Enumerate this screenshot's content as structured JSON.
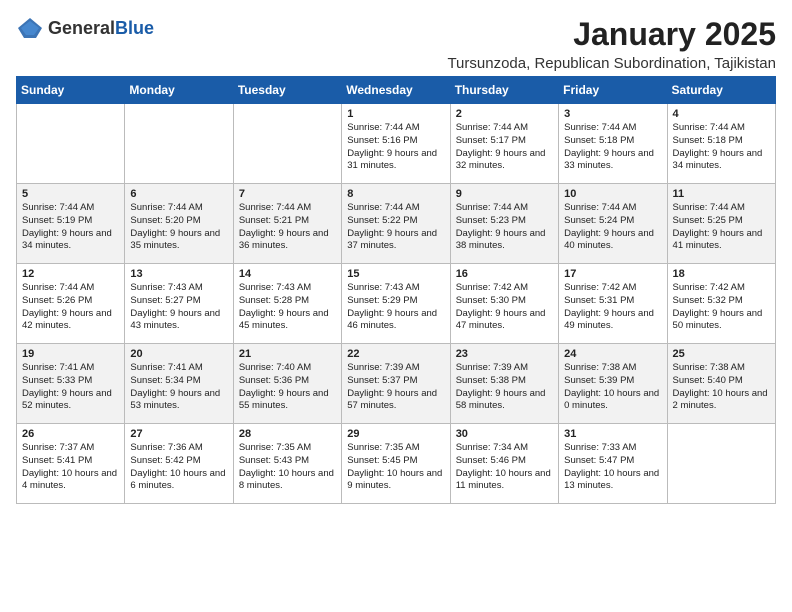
{
  "header": {
    "logo_general": "General",
    "logo_blue": "Blue",
    "month_title": "January 2025",
    "location": "Tursunzoda, Republican Subordination, Tajikistan"
  },
  "weekdays": [
    "Sunday",
    "Monday",
    "Tuesday",
    "Wednesday",
    "Thursday",
    "Friday",
    "Saturday"
  ],
  "weeks": [
    [
      {
        "day": "",
        "info": ""
      },
      {
        "day": "",
        "info": ""
      },
      {
        "day": "",
        "info": ""
      },
      {
        "day": "1",
        "info": "Sunrise: 7:44 AM\nSunset: 5:16 PM\nDaylight: 9 hours and 31 minutes."
      },
      {
        "day": "2",
        "info": "Sunrise: 7:44 AM\nSunset: 5:17 PM\nDaylight: 9 hours and 32 minutes."
      },
      {
        "day": "3",
        "info": "Sunrise: 7:44 AM\nSunset: 5:18 PM\nDaylight: 9 hours and 33 minutes."
      },
      {
        "day": "4",
        "info": "Sunrise: 7:44 AM\nSunset: 5:18 PM\nDaylight: 9 hours and 34 minutes."
      }
    ],
    [
      {
        "day": "5",
        "info": "Sunrise: 7:44 AM\nSunset: 5:19 PM\nDaylight: 9 hours and 34 minutes."
      },
      {
        "day": "6",
        "info": "Sunrise: 7:44 AM\nSunset: 5:20 PM\nDaylight: 9 hours and 35 minutes."
      },
      {
        "day": "7",
        "info": "Sunrise: 7:44 AM\nSunset: 5:21 PM\nDaylight: 9 hours and 36 minutes."
      },
      {
        "day": "8",
        "info": "Sunrise: 7:44 AM\nSunset: 5:22 PM\nDaylight: 9 hours and 37 minutes."
      },
      {
        "day": "9",
        "info": "Sunrise: 7:44 AM\nSunset: 5:23 PM\nDaylight: 9 hours and 38 minutes."
      },
      {
        "day": "10",
        "info": "Sunrise: 7:44 AM\nSunset: 5:24 PM\nDaylight: 9 hours and 40 minutes."
      },
      {
        "day": "11",
        "info": "Sunrise: 7:44 AM\nSunset: 5:25 PM\nDaylight: 9 hours and 41 minutes."
      }
    ],
    [
      {
        "day": "12",
        "info": "Sunrise: 7:44 AM\nSunset: 5:26 PM\nDaylight: 9 hours and 42 minutes."
      },
      {
        "day": "13",
        "info": "Sunrise: 7:43 AM\nSunset: 5:27 PM\nDaylight: 9 hours and 43 minutes."
      },
      {
        "day": "14",
        "info": "Sunrise: 7:43 AM\nSunset: 5:28 PM\nDaylight: 9 hours and 45 minutes."
      },
      {
        "day": "15",
        "info": "Sunrise: 7:43 AM\nSunset: 5:29 PM\nDaylight: 9 hours and 46 minutes."
      },
      {
        "day": "16",
        "info": "Sunrise: 7:42 AM\nSunset: 5:30 PM\nDaylight: 9 hours and 47 minutes."
      },
      {
        "day": "17",
        "info": "Sunrise: 7:42 AM\nSunset: 5:31 PM\nDaylight: 9 hours and 49 minutes."
      },
      {
        "day": "18",
        "info": "Sunrise: 7:42 AM\nSunset: 5:32 PM\nDaylight: 9 hours and 50 minutes."
      }
    ],
    [
      {
        "day": "19",
        "info": "Sunrise: 7:41 AM\nSunset: 5:33 PM\nDaylight: 9 hours and 52 minutes."
      },
      {
        "day": "20",
        "info": "Sunrise: 7:41 AM\nSunset: 5:34 PM\nDaylight: 9 hours and 53 minutes."
      },
      {
        "day": "21",
        "info": "Sunrise: 7:40 AM\nSunset: 5:36 PM\nDaylight: 9 hours and 55 minutes."
      },
      {
        "day": "22",
        "info": "Sunrise: 7:39 AM\nSunset: 5:37 PM\nDaylight: 9 hours and 57 minutes."
      },
      {
        "day": "23",
        "info": "Sunrise: 7:39 AM\nSunset: 5:38 PM\nDaylight: 9 hours and 58 minutes."
      },
      {
        "day": "24",
        "info": "Sunrise: 7:38 AM\nSunset: 5:39 PM\nDaylight: 10 hours and 0 minutes."
      },
      {
        "day": "25",
        "info": "Sunrise: 7:38 AM\nSunset: 5:40 PM\nDaylight: 10 hours and 2 minutes."
      }
    ],
    [
      {
        "day": "26",
        "info": "Sunrise: 7:37 AM\nSunset: 5:41 PM\nDaylight: 10 hours and 4 minutes."
      },
      {
        "day": "27",
        "info": "Sunrise: 7:36 AM\nSunset: 5:42 PM\nDaylight: 10 hours and 6 minutes."
      },
      {
        "day": "28",
        "info": "Sunrise: 7:35 AM\nSunset: 5:43 PM\nDaylight: 10 hours and 8 minutes."
      },
      {
        "day": "29",
        "info": "Sunrise: 7:35 AM\nSunset: 5:45 PM\nDaylight: 10 hours and 9 minutes."
      },
      {
        "day": "30",
        "info": "Sunrise: 7:34 AM\nSunset: 5:46 PM\nDaylight: 10 hours and 11 minutes."
      },
      {
        "day": "31",
        "info": "Sunrise: 7:33 AM\nSunset: 5:47 PM\nDaylight: 10 hours and 13 minutes."
      },
      {
        "day": "",
        "info": ""
      }
    ]
  ]
}
